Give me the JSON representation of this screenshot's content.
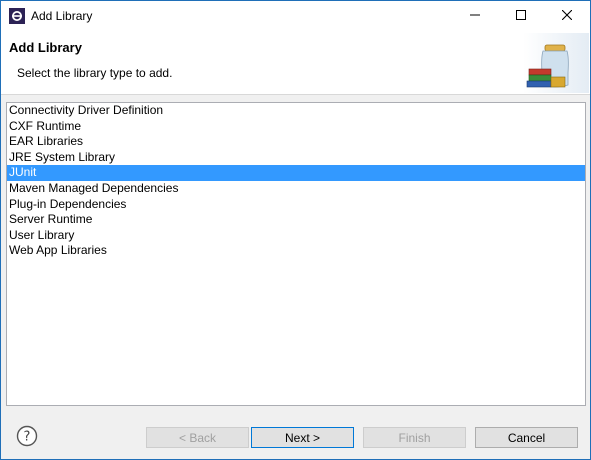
{
  "window": {
    "title": "Add Library",
    "icon": "eclipse-icon",
    "controls": [
      "minimize-icon",
      "maximize-icon",
      "close-icon"
    ]
  },
  "banner": {
    "title": "Add Library",
    "description": "Select the library type to add.",
    "image": "library-jar-books-image"
  },
  "library_types": {
    "items": [
      "Connectivity Driver Definition",
      "CXF Runtime",
      "EAR Libraries",
      "JRE System Library",
      "JUnit",
      "Maven Managed Dependencies",
      "Plug-in Dependencies",
      "Server Runtime",
      "User Library",
      "Web App Libraries"
    ],
    "selected": "JUnit"
  },
  "footer": {
    "help_icon": "help-icon",
    "back_label": "< Back",
    "next_label": "Next >",
    "finish_label": "Finish",
    "cancel_label": "Cancel"
  },
  "colors": {
    "selection": "#3399ff",
    "window_border": "#1f6fb8",
    "default_button_border": "#0078d7"
  }
}
